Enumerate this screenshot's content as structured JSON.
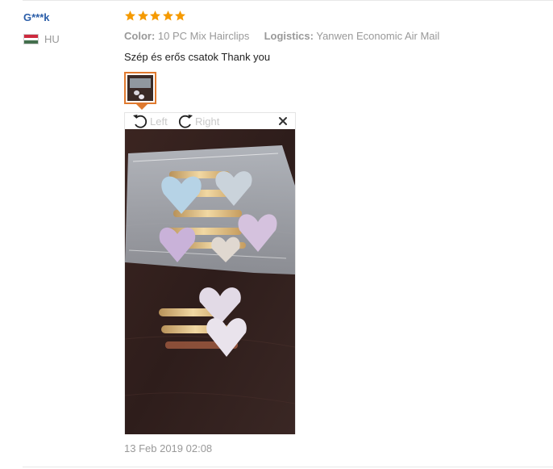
{
  "review": {
    "user_name": "G***k",
    "country_code": "HU",
    "rating": 5,
    "color_label": "Color:",
    "color_value": "10 PC Mix Hairclips",
    "logistics_label": "Logistics:",
    "logistics_value": "Yanwen Economic Air Mail",
    "text": "Szép és erős csatok Thank you",
    "date": "13 Feb 2019 02:08"
  },
  "viewer": {
    "rotate_left_label": "Left",
    "rotate_right_label": "Right",
    "close_icon": "close-icon"
  },
  "colors": {
    "star": "#f59a00",
    "username": "#2a5da8",
    "thumb_border": "#e07a2f",
    "muted_text": "#999999"
  }
}
